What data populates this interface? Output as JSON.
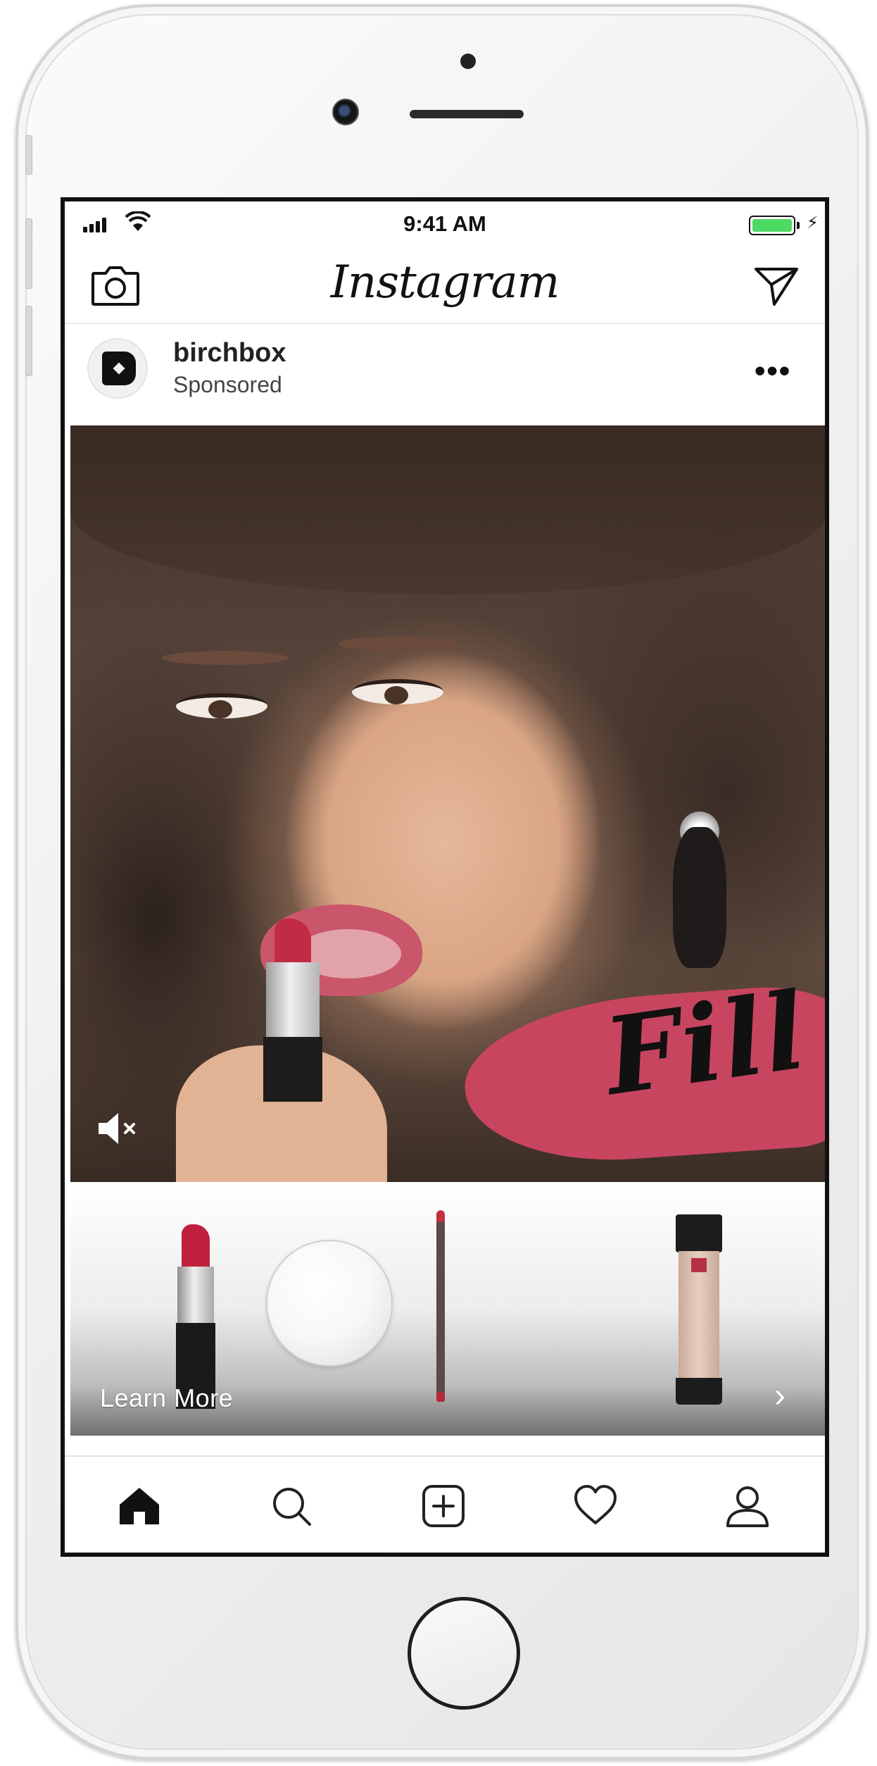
{
  "status_bar": {
    "time": "9:41 AM",
    "battery_color": "#4cd964"
  },
  "header": {
    "app_name": "Instagram",
    "left_icon": "camera-icon",
    "right_icon": "direct-message-icon"
  },
  "post": {
    "username": "birchbox",
    "subtitle": "Sponsored",
    "menu_icon": "more-options-icon",
    "overlay_text": "Fill",
    "overlay_color": "#c8455f",
    "mute_icon": "muted-speaker-icon"
  },
  "products": {
    "items": [
      "lipstick",
      "compact",
      "lip-pencil",
      "foundation"
    ],
    "cta_label": "Learn More",
    "cta_chevron": "›"
  },
  "tab_bar": {
    "tabs": [
      "home-icon",
      "search-icon",
      "new-post-icon",
      "activity-heart-icon",
      "profile-icon"
    ]
  }
}
